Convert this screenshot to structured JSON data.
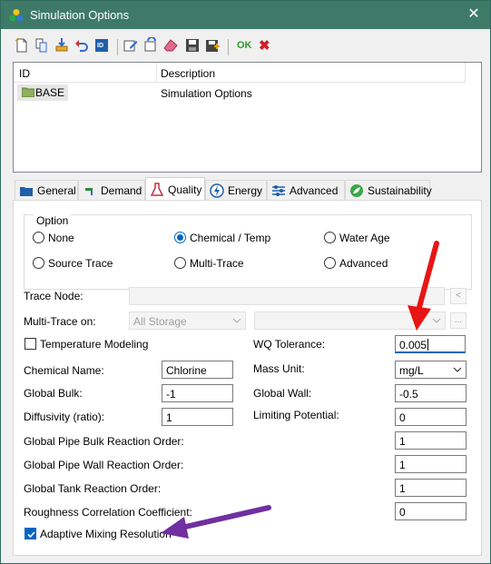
{
  "window": {
    "title": "Simulation Options"
  },
  "toolbar": {
    "buttons": [
      "new-icon",
      "copy-icon",
      "import-icon",
      "undo-icon",
      "id-icon",
      "edit-icon",
      "rename-icon",
      "erase-icon",
      "save-icon",
      "save-as-icon"
    ],
    "ok_label": "OK",
    "cancel_glyph": "✖"
  },
  "list": {
    "col_id": "ID",
    "col_desc": "Description",
    "rows": [
      {
        "id": "BASE",
        "description": "Simulation Options"
      }
    ]
  },
  "tabs": [
    "General",
    "Demand",
    "Quality",
    "Energy",
    "Advanced",
    "Sustainability"
  ],
  "active_tab": "Quality",
  "option": {
    "title": "Option",
    "radios": [
      "None",
      "Chemical / Temp",
      "Water Age",
      "Source Trace",
      "Multi-Trace",
      "Advanced"
    ],
    "selected": "Chemical / Temp"
  },
  "trace_node": {
    "label": "Trace Node:",
    "value": "",
    "browse": "<"
  },
  "multi_trace": {
    "label": "Multi-Trace on:",
    "value": "All Storage",
    "second_value": "",
    "browse": "..."
  },
  "temperature_modeling": {
    "label": "Temperature Modeling",
    "checked": false
  },
  "wq_tolerance": {
    "label": "WQ Tolerance:",
    "value": "0.005"
  },
  "chemical_name": {
    "label": "Chemical Name:",
    "value": "Chlorine"
  },
  "mass_unit": {
    "label": "Mass Unit:",
    "value": "mg/L"
  },
  "global_bulk": {
    "label": "Global Bulk:",
    "value": "-1"
  },
  "global_wall": {
    "label": "Global Wall:",
    "value": "-0.5"
  },
  "diffusivity": {
    "label": "Diffusivity (ratio):",
    "value": "1"
  },
  "limiting_potential": {
    "label": "Limiting Potential:",
    "value": "0"
  },
  "pipe_bulk_order": {
    "label": "Global Pipe Bulk Reaction Order:",
    "value": "1"
  },
  "pipe_wall_order": {
    "label": "Global Pipe Wall Reaction Order:",
    "value": "1"
  },
  "tank_order": {
    "label": "Global Tank Reaction Order:",
    "value": "1"
  },
  "roughness_coeff": {
    "label": "Roughness Correlation Coefficient:",
    "value": "0"
  },
  "adaptive_mixing": {
    "label": "Adaptive Mixing Resolution",
    "checked": true
  },
  "colors": {
    "titlebar": "#3f7a69",
    "accent": "#0067c0",
    "arrow_red": "#e81515",
    "arrow_purple": "#7030a0"
  }
}
